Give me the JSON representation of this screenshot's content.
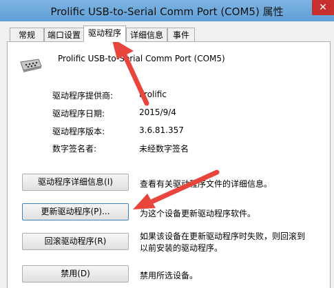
{
  "window": {
    "title": "Prolific USB-to-Serial Comm Port (COM5) 属性",
    "close_glyph": "✕"
  },
  "tabs": [
    {
      "label": "常规"
    },
    {
      "label": "端口设置"
    },
    {
      "label": "驱动程序"
    },
    {
      "label": "详细信息"
    },
    {
      "label": "事件"
    }
  ],
  "device": {
    "name": "Prolific USB-to-Serial Comm Port (COM5)",
    "icon": "serial-port-icon"
  },
  "properties": [
    {
      "label": "驱动程序提供商:",
      "value": "Prolific"
    },
    {
      "label": "驱动程序日期:",
      "value": "2015/9/4"
    },
    {
      "label": "驱动程序版本:",
      "value": "3.6.81.357"
    },
    {
      "label": "数字签名者:",
      "value": "未经数字签名"
    }
  ],
  "actions": [
    {
      "button": "驱动程序详细信息(I)",
      "description": "查看有关驱动程序文件的详细信息。"
    },
    {
      "button": "更新驱动程序(P)...",
      "description": "为这个设备更新驱动程序软件。"
    },
    {
      "button": "回滚驱动程序(R)",
      "description_line1": "如果该设备在更新驱动程序时失败，则回滚到",
      "description_line2": "以前安装的驱动程序。"
    },
    {
      "button": "禁用(D)",
      "description": "禁用所选设备。"
    }
  ],
  "colors": {
    "annotation_arrow": "#e8453c",
    "titlebar": "#6fa8dc",
    "close_button": "#c7302f"
  }
}
